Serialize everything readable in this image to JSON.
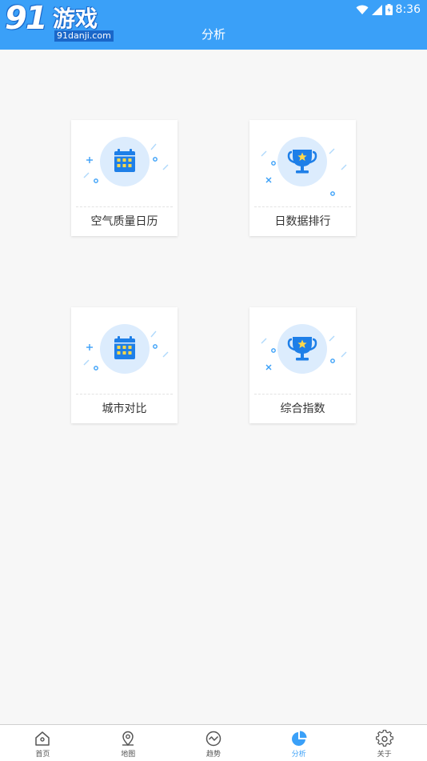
{
  "watermark": {
    "number": "91",
    "name": "游戏",
    "url": "91danji.com"
  },
  "status_bar": {
    "time": "8:36"
  },
  "header": {
    "title": "分析"
  },
  "cards": [
    {
      "label": "空气质量日历",
      "icon": "calendar-icon"
    },
    {
      "label": "日数据排行",
      "icon": "trophy-icon"
    },
    {
      "label": "城市对比",
      "icon": "calendar-icon"
    },
    {
      "label": "综合指数",
      "icon": "trophy-icon"
    }
  ],
  "tabs": [
    {
      "label": "首页",
      "icon": "home-icon",
      "active": false
    },
    {
      "label": "地图",
      "icon": "map-pin-icon",
      "active": false
    },
    {
      "label": "趋势",
      "icon": "trend-icon",
      "active": false
    },
    {
      "label": "分析",
      "icon": "pie-chart-icon",
      "active": true
    },
    {
      "label": "关于",
      "icon": "gear-icon",
      "active": false
    }
  ],
  "colors": {
    "primary": "#3aa0f8",
    "accent_yellow": "#ffd84a",
    "background": "#f7f7f7"
  }
}
